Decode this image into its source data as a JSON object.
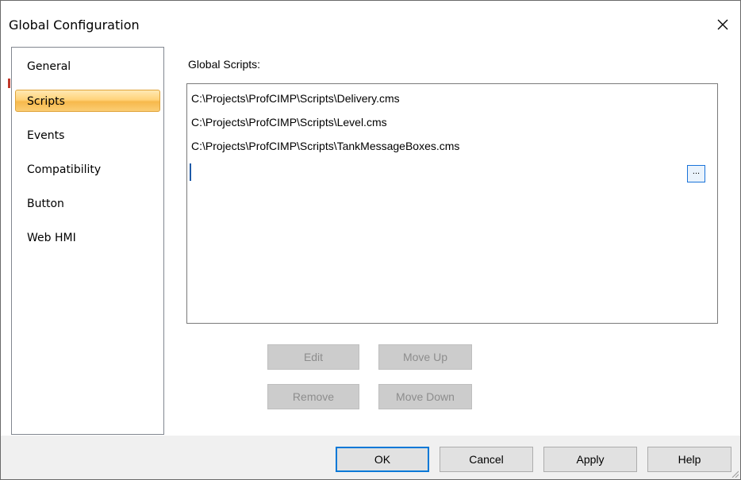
{
  "window": {
    "title": "Global Configuration",
    "close_icon": "close-icon",
    "close_glyph": "✕"
  },
  "nav": {
    "items": [
      {
        "label": "General",
        "selected": false
      },
      {
        "label": "Scripts",
        "selected": true
      },
      {
        "label": "Events",
        "selected": false
      },
      {
        "label": "Compatibility",
        "selected": false
      },
      {
        "label": "Button",
        "selected": false
      },
      {
        "label": "Web HMI",
        "selected": false
      }
    ]
  },
  "scripts": {
    "label": "Global Scripts:",
    "items": [
      "C:\\Projects\\ProfCIMP\\Scripts\\Delivery.cms",
      "C:\\Projects\\ProfCIMP\\Scripts\\Level.cms",
      "C:\\Projects\\ProfCIMP\\Scripts\\TankMessageBoxes.cms"
    ],
    "new_entry_value": "",
    "browse_label": "..."
  },
  "actions": {
    "edit": {
      "label": "Edit",
      "enabled": false
    },
    "move_up": {
      "label": "Move Up",
      "enabled": false
    },
    "remove": {
      "label": "Remove",
      "enabled": false
    },
    "move_down": {
      "label": "Move Down",
      "enabled": false
    }
  },
  "footer": {
    "ok": "OK",
    "cancel": "Cancel",
    "apply": "Apply",
    "help": "Help"
  },
  "colors": {
    "selected_nav_gradient": "#f7b94c",
    "focus_blue": "#0078d7",
    "disabled_button": "#cccccc",
    "disabled_text": "#8d8d8d"
  }
}
